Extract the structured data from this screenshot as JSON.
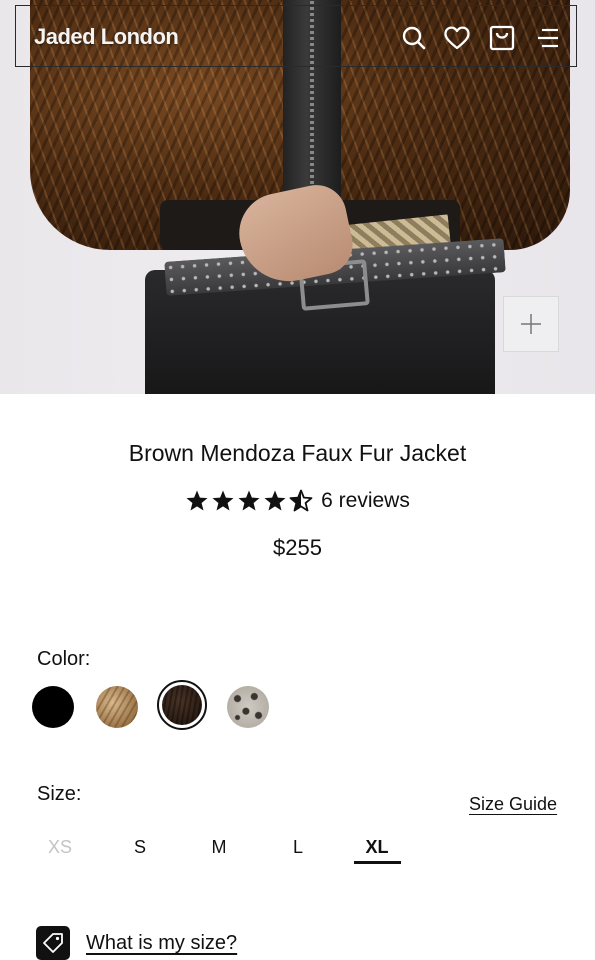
{
  "header": {
    "logo": "Jaded London"
  },
  "product": {
    "title": "Brown Mendoza Faux Fur Jacket",
    "rating": 4.5,
    "reviews_label": "6 reviews",
    "price": "$255"
  },
  "color": {
    "label": "Color:",
    "options": [
      "black",
      "tan-fur",
      "brown-fur",
      "leopard"
    ],
    "selected": "brown-fur"
  },
  "size": {
    "label": "Size:",
    "guide_label": "Size Guide",
    "options": [
      "XS",
      "S",
      "M",
      "L",
      "XL"
    ],
    "selected": "XL",
    "unavailable": [
      "XS"
    ]
  },
  "fit": {
    "link_label": "What is my size?"
  }
}
